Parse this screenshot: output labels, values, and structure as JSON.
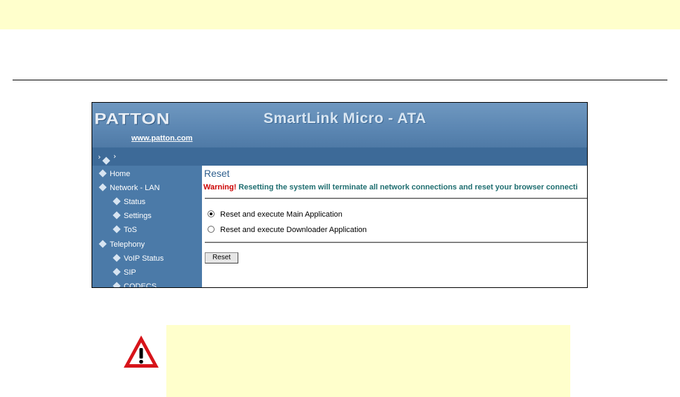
{
  "banner": {
    "logo": "PATTON",
    "product": "SmartLink Micro - ATA",
    "link": "www.patton.com"
  },
  "breadcrumb": {
    "prefix": "›",
    "suffix": "›"
  },
  "sidebar": {
    "items": [
      {
        "label": "Home",
        "level": 0
      },
      {
        "label": "Network - LAN",
        "level": 0
      },
      {
        "label": "Status",
        "level": 1
      },
      {
        "label": "Settings",
        "level": 1
      },
      {
        "label": "ToS",
        "level": 1
      },
      {
        "label": "Telephony",
        "level": 0
      },
      {
        "label": "VoIP Status",
        "level": 1
      },
      {
        "label": "SIP",
        "level": 1
      },
      {
        "label": "CODECS",
        "level": 1
      }
    ]
  },
  "main": {
    "title": "Reset",
    "warning_label": "Warning!",
    "warning_text": " Resetting the system will terminate all network connections and reset your browser connecti",
    "options": [
      {
        "label": "Reset and execute Main Application",
        "checked": true
      },
      {
        "label": "Reset and execute Downloader Application",
        "checked": false
      }
    ],
    "button": "Reset"
  },
  "icons": {
    "caution": "warning-triangle-icon",
    "nav": "diamond-bullet-icon"
  },
  "colors": {
    "band": "#ffffcc",
    "sidebar": "#4b7aa8",
    "warning": "#cc0000",
    "caution_red": "#d7141a"
  }
}
